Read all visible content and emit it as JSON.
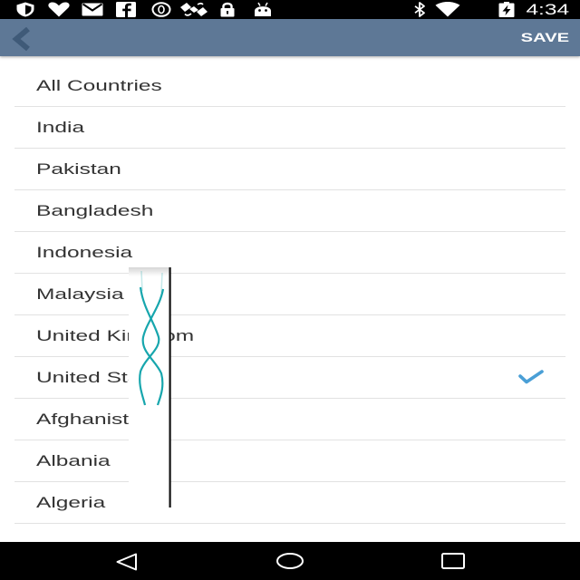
{
  "status_bar": {
    "background": "#000000",
    "time": "4:34",
    "icons_left": [
      "shield-icon",
      "heart-icon",
      "mail-icon",
      "facebook-icon",
      "circle-icon",
      "satellite-icon",
      "lock-icon",
      "android-icon"
    ],
    "icons_right": [
      "bluetooth-icon",
      "wifi-icon",
      "battery-charging-icon"
    ]
  },
  "app_bar": {
    "background": "#5e7896",
    "back_icon": "chevron-left-icon",
    "save_label": "SAVE"
  },
  "country_list": {
    "items": [
      {
        "name": "All Countries",
        "selected": false
      },
      {
        "name": "India",
        "selected": false
      },
      {
        "name": "Pakistan",
        "selected": false
      },
      {
        "name": "Bangladesh",
        "selected": false
      },
      {
        "name": "Indonesia",
        "selected": false
      },
      {
        "name": "Malaysia",
        "selected": false
      },
      {
        "name": "United Kingdom",
        "selected": false
      },
      {
        "name": "United States",
        "selected": true
      },
      {
        "name": "Afghanistan",
        "selected": false
      },
      {
        "name": "Albania",
        "selected": false
      },
      {
        "name": "Algeria",
        "selected": false
      }
    ],
    "check_icon": "checkmark-icon",
    "check_color": "#4a9fd6"
  },
  "nav_bar": {
    "icons": [
      "back-icon",
      "home-icon",
      "recents-icon"
    ]
  }
}
